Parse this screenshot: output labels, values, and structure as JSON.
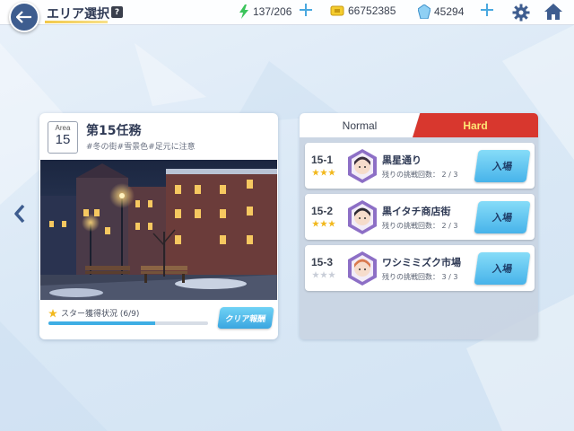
{
  "header": {
    "title": "エリア選択",
    "help": "?",
    "stamina": "137/206",
    "coins": "66752385",
    "gems": "45294"
  },
  "area": {
    "badge_label": "Area",
    "badge_number": "15",
    "title": "第15任務",
    "tags": "#冬の街#雪景色#足元に注意",
    "star_status": "スター獲得状況 (6/9)",
    "star_progress": 0.67,
    "reward_button": "クリア報酬"
  },
  "tabs": {
    "normal": "Normal",
    "hard": "Hard",
    "active": "hard"
  },
  "stages": [
    {
      "code": "15-1",
      "name": "黒星通り",
      "attempts": "残りの挑戦回数：  2 / 3",
      "stars": 3,
      "button": "入場"
    },
    {
      "code": "15-2",
      "name": "黒イタチ商店街",
      "attempts": "残りの挑戦回数：  2 / 3",
      "stars": 3,
      "button": "入場"
    },
    {
      "code": "15-3",
      "name": "ワシミミズク市場",
      "attempts": "残りの挑戦回数：  3 / 3",
      "stars": 0,
      "button": "入場"
    }
  ],
  "colors": {
    "accent": "#3eaee4",
    "hard_tab": "#d8372e",
    "hard_text": "#ffe676",
    "star": "#f2b81c"
  },
  "icons": [
    "back-arrow-icon",
    "help-icon",
    "stamina-bolt-icon",
    "coin-ticket-icon",
    "gem-icon",
    "plus-icon",
    "gear-icon",
    "home-icon",
    "chevron-left-icon",
    "star-icon",
    "student-portrait-icon"
  ]
}
